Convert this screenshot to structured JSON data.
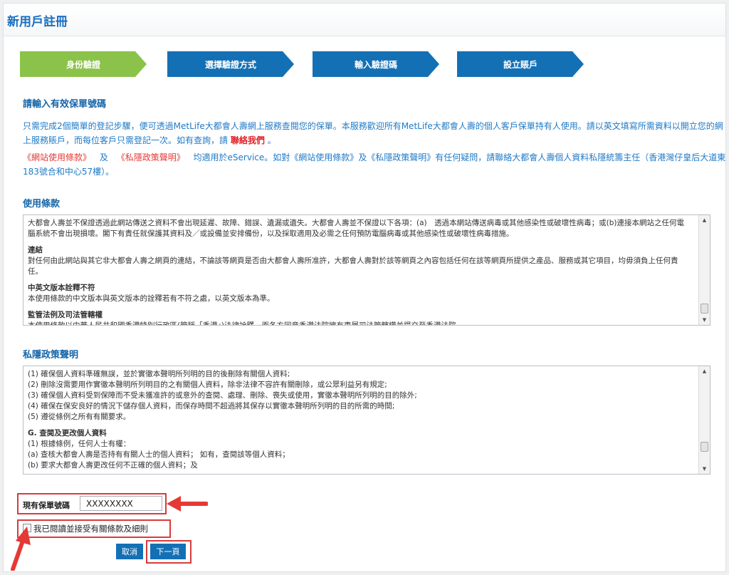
{
  "page": {
    "title": "新用戶註冊"
  },
  "steps": [
    {
      "label": "身份驗證",
      "active": true
    },
    {
      "label": "選擇驗證方式",
      "active": false
    },
    {
      "label": "輸入驗證碼",
      "active": false
    },
    {
      "label": "設立賬戶",
      "active": false
    }
  ],
  "policy_number_section": {
    "title": "請輸入有效保單號碼",
    "intro_before_link": "只需完成2個簡單的登記步驟，便可透過MetLife大都會人壽網上服務查閱您的保單。本服務歡迎所有MetLife大都會人壽的個人客戶保單持有人使用。請以英文填寫所需資料以開立您的網上服務賬戶，而每位客戶只需登記一次。如有查詢，請",
    "contact_link": "聯絡我們",
    "intro_after_link": "。",
    "terms_link": "《網站使用條款》",
    "and_text": "及",
    "privacy_link": "《私隱政策聲明》",
    "policy_notice": "均適用於eService。如對《網站使用條款》及《私隱政策聲明》有任何疑問，請聯絡大都會人壽個人資料私隱統籌主任（香港灣仔皇后大道東183號合和中心57樓）。"
  },
  "terms_section": {
    "title": "使用條款",
    "lines": [
      {
        "text": "大都會人壽並不保證透過此網站傳送之資料不會出現延遲、故障、錯誤、遺漏或遺失。大都會人壽並不保證以下各項：(a)　透過本網站傳送病毒或其他感染性或破壞性病毒；或(b)連接本網站之任何電",
        "bold": false
      },
      {
        "text": "腦系統不會出現損壞。閣下有責任就保護其資料及／或設備並安排備份，以及採取適用及必需之任何預防電腦病毒或其他感染性或破壞性病毒措施。",
        "bold": false
      },
      {
        "text": "連結",
        "bold": true
      },
      {
        "text": "對任何由此網站與其它非大都會人壽之網頁的連結，不論該等網頁是否由大都會人壽所准許，大都會人壽對於該等網頁之內容包括任何在該等網頁所提供之產品、服務或其它項目，均毋須負上任何責",
        "bold": false
      },
      {
        "text": "任。",
        "bold": false
      },
      {
        "text": "中英文版本詮釋不符",
        "bold": true
      },
      {
        "text": "本使用條款的中文版本與英文版本的詮釋若有不符之處，以英文版本為準。",
        "bold": false
      },
      {
        "text": "監管法例及司法管轄權",
        "bold": true
      },
      {
        "text": "本使用條款以中華人民共和國香港特別行政區(簡稱「香港」)法律詮釋，而各方同意香港法院擁有專屬司法管轄權並提交至香港法院。",
        "bold": false
      }
    ]
  },
  "privacy_section": {
    "title": "私隱政策聲明",
    "lines": [
      {
        "text": "(1) 確保個人資料準確無誤，並於實徹本聲明所列明的目的後刪除有關個人資料;",
        "bold": false
      },
      {
        "text": "(2) 刪除沒需要用作實徹本聲明所列明目的之有關個人資料，除非法律不容許有關刪除，或公眾利益另有規定;",
        "bold": false
      },
      {
        "text": "(3) 確保個人資料受到保障而不受未獲准許的或意外的查閱、處理、刪除、喪失或使用，實徹本聲明所列明的目的除外;",
        "bold": false
      },
      {
        "text": "(4) 確保在保安良好的情況下儲存個人資料，而保存時間不超過將其保存以實徹本聲明所列明的目的所需的時間;",
        "bold": false
      },
      {
        "text": "(5) 遵從條例之所有有關要求。",
        "bold": false
      },
      {
        "text": "G. 查閱及更改個人資料",
        "bold": true
      },
      {
        "text": "(1) 根據條例，任何人士有權：",
        "bold": false
      },
      {
        "text": "(a) 查核大都會人壽是否持有有關人士的個人資料； 如有，查閱該等個人資料；",
        "bold": false
      },
      {
        "text": "(b) 要求大都會人壽更改任何不正確的個人資料；及",
        "bold": false
      }
    ]
  },
  "form": {
    "policy_number_label": "現有保單號碼",
    "policy_number_value": "XXXXXXXX",
    "agree_label": "我已閱讀並接受有關條款及細則",
    "agree_checked": false,
    "cancel_label": "取消",
    "next_label": "下一頁"
  },
  "colors": {
    "step_active": "#8bc34a",
    "step_inactive": "#1470b5",
    "link_blue": "#1f7ac6",
    "highlight_red": "#d93b3b"
  }
}
